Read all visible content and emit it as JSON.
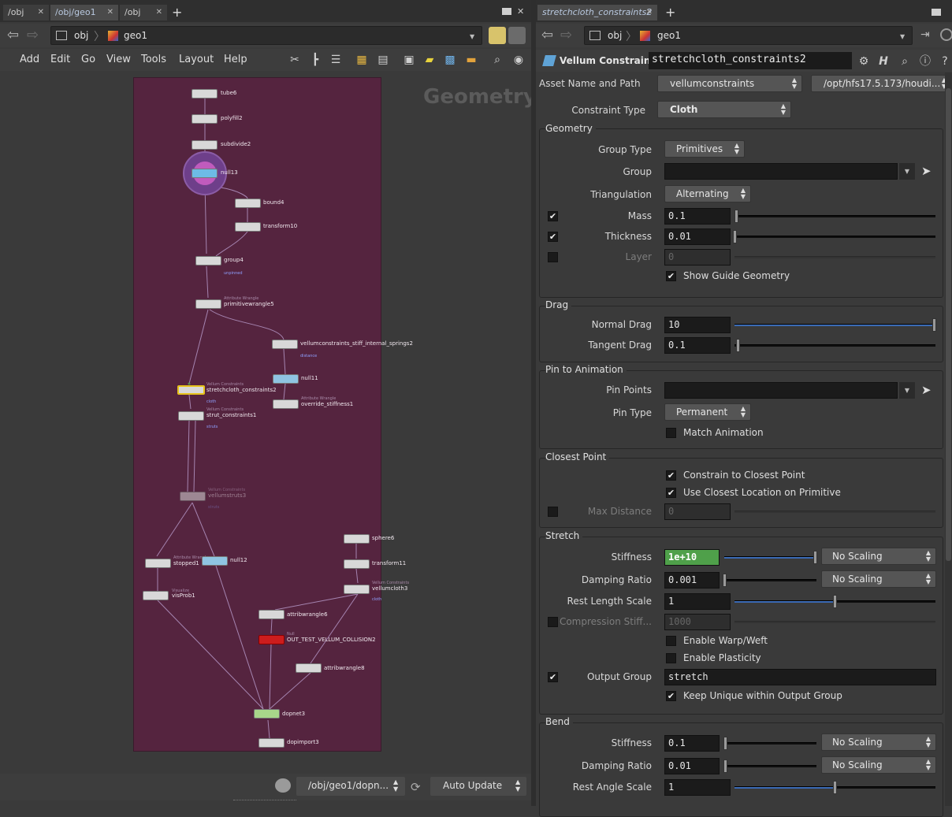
{
  "left_tabs": [
    "/obj",
    "/obj/geo1",
    "/obj"
  ],
  "right_tabs": [
    "stretchcloth_constraints2"
  ],
  "path": {
    "root": "obj",
    "node": "geo1"
  },
  "menu": [
    "Add",
    "Edit",
    "Go",
    "View",
    "Tools",
    "Layout",
    "Help"
  ],
  "network": {
    "context_label": "Geometry",
    "nodes": [
      {
        "name": "tube6"
      },
      {
        "name": "polyfill2"
      },
      {
        "name": "subdivide2"
      },
      {
        "name": "null13"
      },
      {
        "name": "bound4"
      },
      {
        "name": "transform10"
      },
      {
        "name": "group4",
        "flag": "unpinned"
      },
      {
        "name": "primitivewrangle5",
        "type": "Attribute Wrangle"
      },
      {
        "name": "vellumconstraints_stiff_internal_springs2",
        "flag": "distance"
      },
      {
        "name": "null11"
      },
      {
        "name": "override_stiffness1",
        "type": "Attribute Wrangle"
      },
      {
        "name": "stretchcloth_constraints2",
        "type": "Vellum Constraints",
        "flag": "cloth"
      },
      {
        "name": "strut_constraints1",
        "type": "Vellum Constraints",
        "flag": "struts"
      },
      {
        "name": "vellumstruts3",
        "type": "Vellum Constraints",
        "flag": "struts"
      },
      {
        "name": "sphere6"
      },
      {
        "name": "transform11"
      },
      {
        "name": "vellumcloth3",
        "type": "Vellum Constraints",
        "flag": "cloth"
      },
      {
        "name": "stopped1",
        "type": "Attribute Wrangle"
      },
      {
        "name": "null12"
      },
      {
        "name": "visProb1",
        "type": "Visualize"
      },
      {
        "name": "attribwrangle6"
      },
      {
        "name": "OUT_TEST_VELLUM_COLLISION2",
        "type": "Null"
      },
      {
        "name": "attribwrangle8"
      },
      {
        "name": "dopnet3"
      },
      {
        "name": "dopimport3"
      }
    ]
  },
  "bottom_bar": {
    "path": "/obj/geo1/dopn...",
    "update_mode": "Auto Update"
  },
  "params": {
    "node_type": "Vellum Constraints",
    "node_name": "stretchcloth_constraints2",
    "asset_label": "Asset Name and Path",
    "asset_name": "vellumconstraints",
    "asset_path": "/opt/hfs17.5.173/houdi...",
    "constraint_type_label": "Constraint Type",
    "constraint_type": "Cloth",
    "geometry": {
      "title": "Geometry",
      "group_type_label": "Group Type",
      "group_type": "Primitives",
      "group_label": "Group",
      "group_value": "",
      "triangulation_label": "Triangulation",
      "triangulation": "Alternating",
      "mass_label": "Mass",
      "mass": "0.1",
      "mass_checked": true,
      "thickness_label": "Thickness",
      "thickness": "0.01",
      "thickness_checked": true,
      "layer_label": "Layer",
      "layer": "0",
      "layer_checked": false,
      "show_guide_label": "Show Guide Geometry",
      "show_guide": true
    },
    "drag": {
      "title": "Drag",
      "normal_label": "Normal Drag",
      "normal": "10",
      "tangent_label": "Tangent Drag",
      "tangent": "0.1"
    },
    "pin": {
      "title": "Pin to Animation",
      "points_label": "Pin Points",
      "points": "",
      "type_label": "Pin Type",
      "type": "Permanent",
      "match_label": "Match Animation",
      "match": false
    },
    "closest": {
      "title": "Closest Point",
      "constrain_label": "Constrain to Closest Point",
      "constrain": true,
      "use_label": "Use Closest Location on Primitive",
      "use": true,
      "maxdist_label": "Max Distance",
      "maxdist": "0",
      "maxdist_checked": false
    },
    "stretch": {
      "title": "Stretch",
      "stiffness_label": "Stiffness",
      "stiffness": "1e+10",
      "stiffness_scaling": "No Scaling",
      "damping_label": "Damping Ratio",
      "damping": "0.001",
      "damping_scaling": "No Scaling",
      "rest_label": "Rest Length Scale",
      "rest": "1",
      "compression_label": "Compression Stiff...",
      "compression": "1000",
      "compression_checked": false,
      "warp_label": "Enable Warp/Weft",
      "warp": false,
      "plasticity_label": "Enable Plasticity",
      "plasticity": false,
      "output_label": "Output Group",
      "output": "stretch",
      "output_checked": true,
      "keep_label": "Keep Unique within Output Group",
      "keep": true
    },
    "bend": {
      "title": "Bend",
      "stiffness_label": "Stiffness",
      "stiffness": "0.1",
      "stiffness_scaling": "No Scaling",
      "damping_label": "Damping Ratio",
      "damping": "0.01",
      "damping_scaling": "No Scaling",
      "rest_label": "Rest Angle Scale",
      "rest": "1"
    }
  },
  "colors": {
    "network_bg": "#55243f",
    "selected": "#e6c21a",
    "stiffness_field": "#4fa04a",
    "slider_fill": "#3b6ab4",
    "error_node": "#cc1d1d",
    "dop_node": "#a8d68a"
  }
}
